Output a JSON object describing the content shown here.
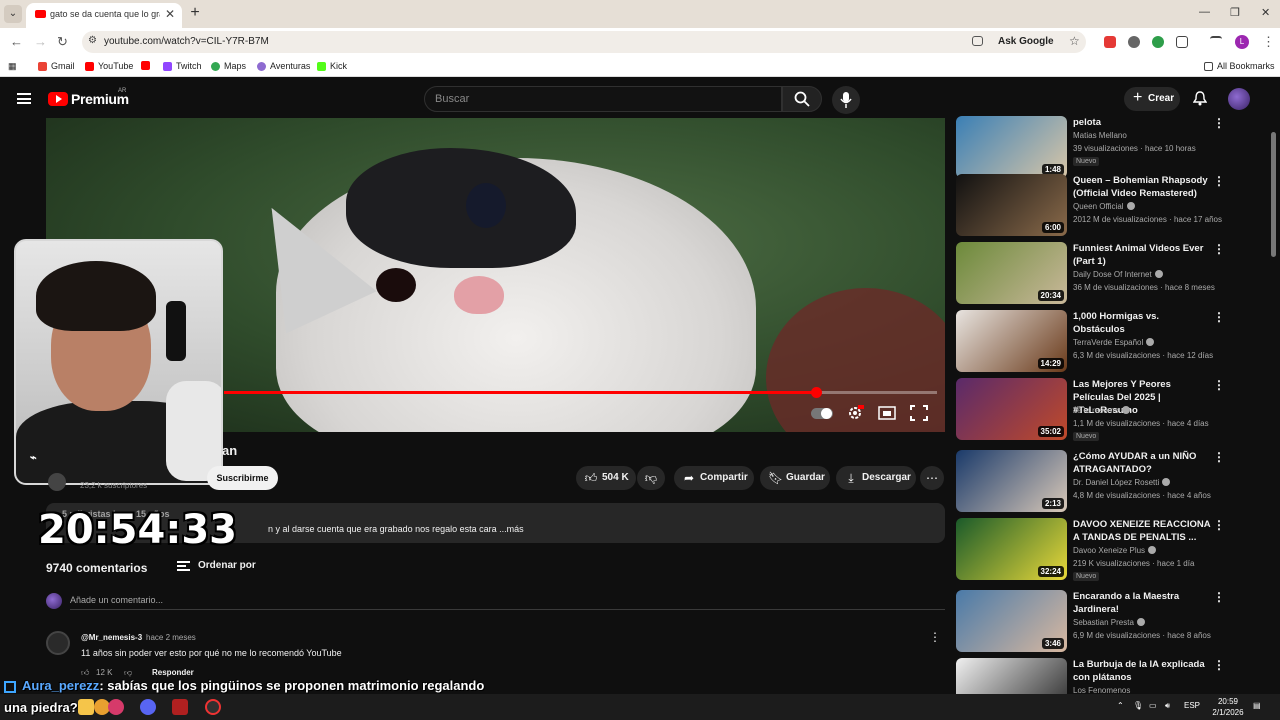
{
  "browser": {
    "tab_title": "gato se da cuenta que lo grabab",
    "url": "youtube.com/watch?v=CIL-Y7R-B7M",
    "ask_google": "Ask Google",
    "all_bookmarks": "All Bookmarks",
    "bookmarks": [
      {
        "label": "Gmail",
        "color": "#ea4335"
      },
      {
        "label": "YouTube",
        "color": "#ff0000"
      },
      {
        "label": "",
        "color": "#ff0000"
      },
      {
        "label": "Twitch",
        "color": "#9146ff"
      },
      {
        "label": "Maps",
        "color": "#34a853"
      },
      {
        "label": "Aventuras",
        "color": "#8e6bd1"
      },
      {
        "label": "Kick",
        "color": "#53fc18"
      }
    ]
  },
  "youtube": {
    "brand": "Premium",
    "region": "AR",
    "search_placeholder": "Buscar",
    "create_label": "Crear",
    "video": {
      "progress": 0.83,
      "title_fragment": "an",
      "subscribers_fragment": "23,2 k suscriptores",
      "subscribe_label": "Suscribirme",
      "likes": "504 K",
      "share": "Compartir",
      "save": "Guardar",
      "download": "Descargar",
      "description_top": "5 mil vistas  hace 15 años",
      "description_text": "n y al darse cuenta que era grabado nos regalo esta cara ...más"
    },
    "comments": {
      "count": "9740 comentarios",
      "sort_label": "Ordenar por",
      "add_placeholder": "Añade un comentario...",
      "first": {
        "author": "@Mr_nemesis-3",
        "time": "hace 2 meses",
        "text": "11 años sin poder ver esto por qué no me lo recomendó YouTube",
        "likes": "12 K",
        "reply": "Responder"
      }
    },
    "recommendations": [
      {
        "title": "pelota",
        "channel": "Matias Mellano",
        "meta": "39 visualizaciones · hace 10 horas",
        "duration": "1:48",
        "badge": "Nuevo",
        "verified": false,
        "colors": [
          "#3a7fb5",
          "#d8c6a8"
        ]
      },
      {
        "title": "Queen – Bohemian Rhapsody (Official Video Remastered)",
        "channel": "Queen Official",
        "meta": "2012 M de visualizaciones · hace 17 años",
        "duration": "6:00",
        "badge": "",
        "verified": true,
        "colors": [
          "#111111",
          "#8a6a4a"
        ]
      },
      {
        "title": "Funniest Animal Videos Ever (Part 1)",
        "channel": "Daily Dose Of Internet",
        "meta": "36 M de visualizaciones · hace 8 meses",
        "duration": "20:34",
        "badge": "",
        "verified": true,
        "colors": [
          "#6c8a3a",
          "#c9b89a"
        ]
      },
      {
        "title": "1,000 Hormigas vs. Obstáculos",
        "channel": "TerraVerde Español",
        "meta": "6,3 M de visualizaciones · hace 12 días",
        "duration": "14:29",
        "badge": "",
        "verified": true,
        "colors": [
          "#e8e4e0",
          "#6a3a1a"
        ]
      },
      {
        "title": "Las Mejores Y Peores Películas Del 2025 | #TeLoResumo",
        "channel": "Te lo resumo",
        "meta": "1,1 M de visualizaciones · hace 4 días",
        "duration": "35:02",
        "badge": "Nuevo",
        "verified": true,
        "colors": [
          "#5a2a6a",
          "#c04a2a"
        ]
      },
      {
        "title": "¿Cómo AYUDAR a un NIÑO ATRAGANTADO?",
        "channel": "Dr. Daniel López Rosetti",
        "meta": "4,8 M de visualizaciones · hace 4 años",
        "duration": "2:13",
        "badge": "",
        "verified": true,
        "colors": [
          "#1a3a6a",
          "#d8c8b8"
        ]
      },
      {
        "title": "DAVOO XENEIZE REACCIONA A TANDAS DE PENALTIS ...",
        "channel": "Davoo Xeneize Plus",
        "meta": "219 K visualizaciones · hace 1 día",
        "duration": "32:24",
        "badge": "Nuevo",
        "verified": true,
        "colors": [
          "#1a5a2a",
          "#e8d83a"
        ]
      },
      {
        "title": "Encarando a la Maestra Jardinera!",
        "channel": "Sebastian Presta",
        "meta": "6,9 M de visualizaciones · hace 8 años",
        "duration": "3:46",
        "badge": "",
        "verified": true,
        "colors": [
          "#4a7aa8",
          "#d8b8a0"
        ]
      },
      {
        "title": "La Burbuja de la IA explicada con plátanos",
        "channel": "Los Fenomenos",
        "meta": "",
        "duration": "",
        "badge": "",
        "verified": false,
        "colors": [
          "#f0f0f0",
          "#222222"
        ]
      }
    ]
  },
  "overlay": {
    "timestamp": "20:54:33",
    "chat_user": "Aura_perezz",
    "chat_text": ": sabías que los pingüinos se proponen matrimonio regalando",
    "chat_text_2": "una piedra?"
  },
  "taskbar": {
    "time": "20:59",
    "date": "2/1/2026",
    "lang": "ESP"
  }
}
